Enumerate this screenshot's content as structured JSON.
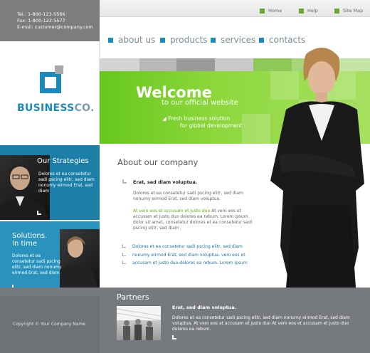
{
  "contact": {
    "tel": "Tel.: 1-800-123-5566",
    "fax": "Fax: 1-800-123-5577",
    "email": "E-mail: customer@company.com"
  },
  "toplinks": [
    {
      "label": "Home",
      "icon": "home-icon"
    },
    {
      "label": "Help",
      "icon": "help-icon"
    },
    {
      "label": "Site Map",
      "icon": "sitemap-icon"
    }
  ],
  "nav": [
    "about us",
    "products",
    "services",
    "contacts"
  ],
  "logo": {
    "main": "BUSINESS",
    "accent": "CO."
  },
  "welcome": {
    "title": "Welcome",
    "subtitle": "to our official website",
    "line1": "Fresh business solution",
    "line2": "for global development"
  },
  "strategies": {
    "title": "Our Strategies",
    "text": "Dolores et ea consetetur sadi pscing elitr, sed diam nonumy eirmod Erat, sed diam"
  },
  "solutions": {
    "title1": "Solutions.",
    "title2": "In time",
    "text": "Dolores et ea consetetur sadi pscing elitr, sed diam nonumy eirmod Erat, sed diam"
  },
  "about": {
    "title": "About our company",
    "head": "Erat, sed diam voluptua.",
    "para1": "Dolores et ea consetetur sadi pscing elitr, sed diam nonumy eirmod Erat, sed diam voluptua.",
    "green": "At vero eos et accusam et justo duo",
    "para2": " At vero eos et accusam et justo duo dolores ea rebum. Lorem ipsum dolor sit amet, consetetur dolores et ea consetetur sadi pscing elitr, sed diam",
    "list": [
      "Dolores et ea consetetur sadi pscing elitr, sed diam",
      "nonumy eirmod Erat, sed diam voluptua. vero eos et",
      "accusam et justo duo dolores ea rebum. Lorem ipsum"
    ]
  },
  "partners": {
    "title": "Partners",
    "head": "Erat, sed diam voluptua.",
    "text": "Dolores et ea consetetur sadi pscing elitr, sed diam nonumy eirmod Erat, sed diam voluptua. At vero eos et accusam et justo duo At vero eos et accusam et justo duo dolores ea rebum."
  },
  "footer": {
    "copyright": "Copyright © Your Company Name"
  },
  "colors": {
    "green": "#7ed230",
    "blue": "#1a89bb",
    "gray": "#76797d"
  }
}
